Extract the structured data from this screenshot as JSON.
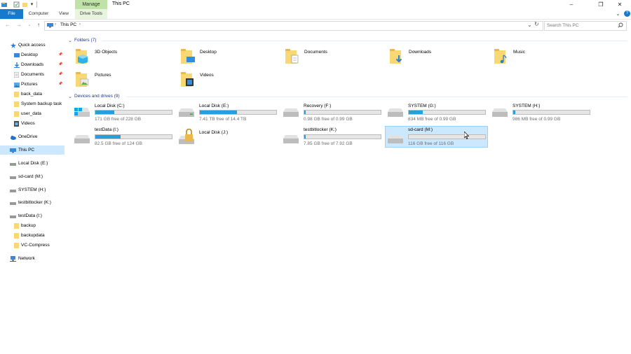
{
  "window": {
    "title": "This PC",
    "manage_tab": "Manage",
    "ribbon_tabs": [
      "File",
      "Computer",
      "View",
      "Drive Tools"
    ]
  },
  "nav": {
    "address_path": "This PC",
    "search_placeholder": "Search This PC"
  },
  "sidebar": {
    "items": [
      {
        "label": "Quick access"
      },
      {
        "label": "Desktop"
      },
      {
        "label": "Downloads"
      },
      {
        "label": "Documents"
      },
      {
        "label": "Pictures"
      },
      {
        "label": "back_data"
      },
      {
        "label": "System backup task"
      },
      {
        "label": "user_data"
      },
      {
        "label": "Videos"
      },
      {
        "label": "OneDrive"
      },
      {
        "label": "This PC"
      },
      {
        "label": "Local Disk (E:)"
      },
      {
        "label": "sd-card (M:)"
      },
      {
        "label": "SYSTEM (H:)"
      },
      {
        "label": "testbitlocker (K:)"
      },
      {
        "label": "testData (I:)"
      },
      {
        "label": "backup"
      },
      {
        "label": "backupdata"
      },
      {
        "label": "VC-Compress"
      },
      {
        "label": "Network"
      }
    ]
  },
  "folders": {
    "header": "Folders (7)",
    "items": [
      {
        "label": "3D Objects",
        "icon": "3d-objects-icon"
      },
      {
        "label": "Desktop",
        "icon": "desktop-folder-icon"
      },
      {
        "label": "Documents",
        "icon": "documents-folder-icon"
      },
      {
        "label": "Downloads",
        "icon": "downloads-folder-icon"
      },
      {
        "label": "Music",
        "icon": "music-folder-icon"
      },
      {
        "label": "Pictures",
        "icon": "pictures-folder-icon"
      },
      {
        "label": "Videos",
        "icon": "videos-folder-icon"
      }
    ]
  },
  "drives": {
    "header": "Devices and drives (9)",
    "items": [
      {
        "name": "Local Disk (C:)",
        "free": "171 GB free of 228 GB",
        "used_fraction": 0.25
      },
      {
        "name": "Local Disk (E:)",
        "free": "7.41 TB free of 14.4 TB",
        "used_fraction": 0.49
      },
      {
        "name": "Recovery (F:)",
        "free": "0.98 GB free of 0.99 GB",
        "used_fraction": 0.01
      },
      {
        "name": "SYSTEM (G:)",
        "free": "834 MB free of 0.99 GB",
        "used_fraction": 0.18
      },
      {
        "name": "SYSTEM (H:)",
        "free": "986 MB free of 0.99 GB",
        "used_fraction": 0.03
      },
      {
        "name": "testData (I:)",
        "free": "82.5 GB free of 124 GB",
        "used_fraction": 0.33
      },
      {
        "name": "Local Disk (J:)",
        "free": "",
        "used_fraction": null
      },
      {
        "name": "testbitlocker (K:)",
        "free": "7.85 GB free of 7.92 GB",
        "used_fraction": 0.01
      },
      {
        "name": "sd-card (M:)",
        "free": "116 GB free of 116 GB",
        "used_fraction": 0.0
      }
    ]
  },
  "colors": {
    "accent": "#1979ca",
    "bar_fill": "#26a0da",
    "selection": "#cce8ff",
    "header_text": "#1e3287",
    "folder_yellow": "#f8d775"
  }
}
